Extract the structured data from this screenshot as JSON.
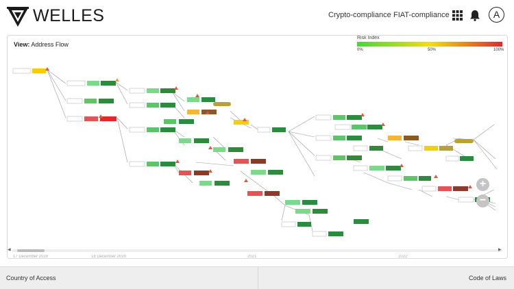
{
  "header": {
    "brand": "WELLES",
    "nav": [
      "Crypto-compliance",
      "FIAT-compliance"
    ],
    "avatar_letter": "A"
  },
  "panel": {
    "view_label": "View:",
    "view_value": "Address Flow",
    "risk_index": {
      "title": "Risk Index",
      "ticks": [
        "0%",
        "50%",
        "100%"
      ]
    },
    "timeline": [
      "17 December 2020",
      "18 December 2020",
      "2021",
      "2022"
    ]
  },
  "zoom": {
    "in": "+",
    "out": "−"
  },
  "footer": {
    "left": "Country of Access",
    "right": "Code of Laws"
  },
  "colors": {
    "low": "#3ddc3d",
    "mid": "#f5e000",
    "high": "#e02a2a",
    "dark_green": "#2e8b3e",
    "green": "#5fc36a",
    "olive": "#b9a234",
    "orange": "#f2a23a",
    "brown": "#8a3c2a"
  }
}
